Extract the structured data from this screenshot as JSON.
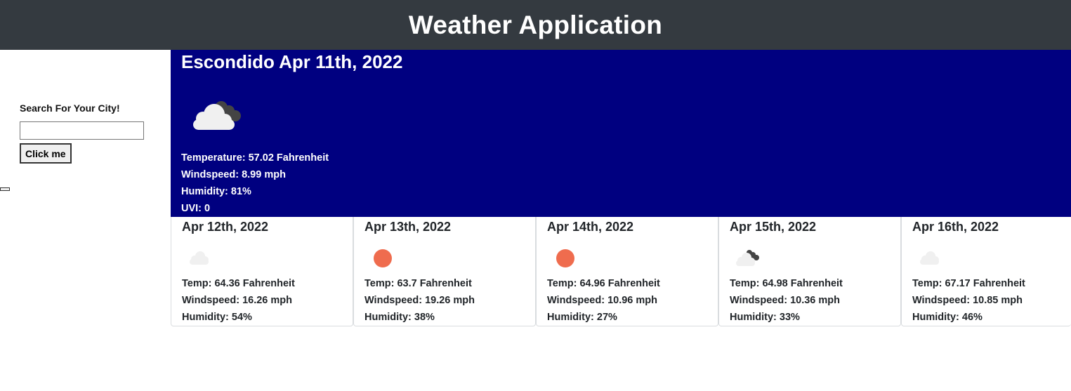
{
  "header": {
    "title": "Weather Application"
  },
  "search": {
    "label": "Search For Your City!",
    "input_value": "",
    "button_label": "Click me"
  },
  "current": {
    "title": "Escondido Apr 11th, 2022",
    "icon": "broken-clouds-icon",
    "temperature": "Temperature: 57.02 Fahrenheit",
    "windspeed": "Windspeed: 8.99 mph",
    "humidity": "Humidity: 81%",
    "uvi": "UVI: 0"
  },
  "forecast": [
    {
      "date": "Apr 12th, 2022",
      "icon": "few-clouds-icon",
      "temp": "Temp: 64.36 Fahrenheit",
      "wind": "Windspeed: 16.26 mph",
      "humidity": "Humidity: 54%"
    },
    {
      "date": "Apr 13th, 2022",
      "icon": "clear-sky-icon",
      "temp": "Temp: 63.7 Fahrenheit",
      "wind": "Windspeed: 19.26 mph",
      "humidity": "Humidity: 38%"
    },
    {
      "date": "Apr 14th, 2022",
      "icon": "clear-sky-icon",
      "temp": "Temp: 64.96 Fahrenheit",
      "wind": "Windspeed: 10.96 mph",
      "humidity": "Humidity: 27%"
    },
    {
      "date": "Apr 15th, 2022",
      "icon": "broken-clouds-icon",
      "temp": "Temp: 64.98 Fahrenheit",
      "wind": "Windspeed: 10.36 mph",
      "humidity": "Humidity: 33%"
    },
    {
      "date": "Apr 16th, 2022",
      "icon": "few-clouds-icon",
      "temp": "Temp: 67.17 Fahrenheit",
      "wind": "Windspeed: 10.85 mph",
      "humidity": "Humidity: 46%"
    }
  ],
  "colors": {
    "header_bg": "#343a40",
    "current_bg": "#000080",
    "sun": "#ef6c4e",
    "cloud_light": "#f0f0f0",
    "cloud_dark": "#444444"
  }
}
